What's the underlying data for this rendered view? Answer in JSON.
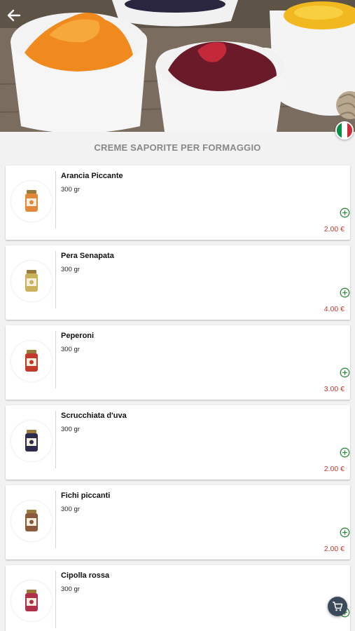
{
  "header": {
    "back_icon": "arrow-left-icon",
    "language_flag": "italy-flag-icon",
    "flag_colors": [
      "#009246",
      "#ffffff",
      "#ce2b37"
    ]
  },
  "section": {
    "title": "CREME SAPORITE PER FORMAGGIO"
  },
  "products": [
    {
      "name": "Arancia Piccante",
      "weight": "300 gr",
      "price": "2.00 €",
      "jar_color": "#e0893a"
    },
    {
      "name": "Pera Senapata",
      "weight": "300 gr",
      "price": "4.00 €",
      "jar_color": "#c9b25a"
    },
    {
      "name": "Peperoni",
      "weight": "300 gr",
      "price": "3.00 €",
      "jar_color": "#c0392b"
    },
    {
      "name": "Scrucchiata d'uva",
      "weight": "300 gr",
      "price": "2.00 €",
      "jar_color": "#2d2b4a"
    },
    {
      "name": "Fichi piccanti",
      "weight": "300 gr",
      "price": "2.00 €",
      "jar_color": "#8a5a3a"
    },
    {
      "name": "Cipolla rossa",
      "weight": "300 gr",
      "price": "",
      "jar_color": "#b0304a"
    }
  ],
  "cart": {
    "icon": "cart-icon"
  },
  "colors": {
    "price": "#c0392b",
    "add": "#2e8b3e",
    "fab": "#3b4a5a"
  }
}
